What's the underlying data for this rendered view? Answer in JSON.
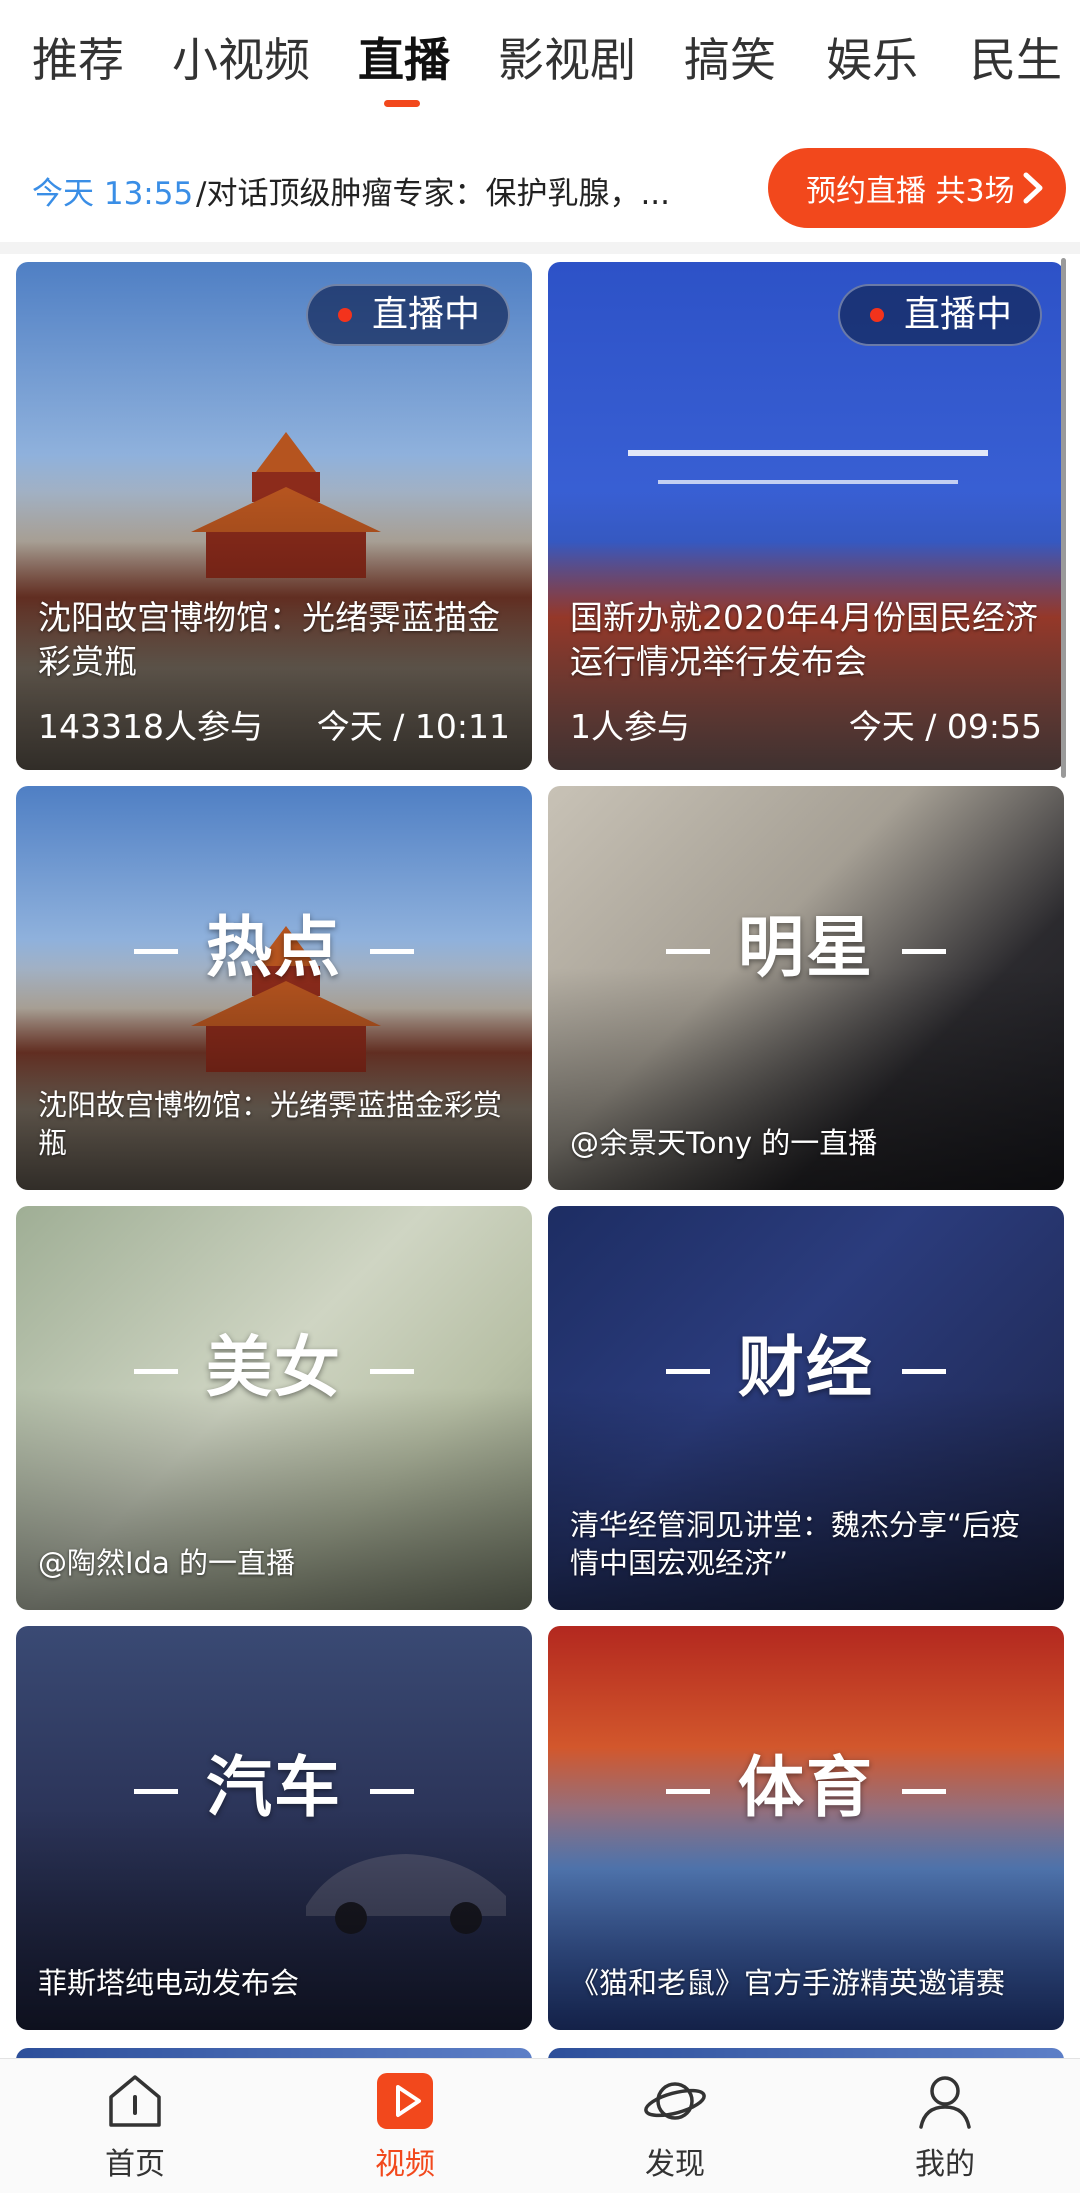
{
  "tabs": [
    "推荐",
    "小视频",
    "直播",
    "影视剧",
    "搞笑",
    "娱乐",
    "民生"
  ],
  "active_tab": "直播",
  "schedule": {
    "time": "今天 13:55",
    "title": "/对话顶级肿瘤专家：保护乳腺，...",
    "reserve_label": "预约直播 共3场"
  },
  "live_cards": [
    {
      "badge": "直播中",
      "title": "沈阳故宫博物馆：光绪霁蓝描金彩赏瓶",
      "participants": "143318人参与",
      "time": "今天 / 10:11"
    },
    {
      "badge": "直播中",
      "title": "国新办就2020年4月份国民经济运行情况举行发布会",
      "participants": "1人参与",
      "time": "今天 / 09:55"
    }
  ],
  "category_cards": [
    {
      "category": "热点",
      "caption": "沈阳故宫博物馆：光绪霁蓝描金彩赏瓶"
    },
    {
      "category": "明星",
      "caption": "@余景天Tony 的一直播"
    },
    {
      "category": "美女",
      "caption": "@陶然Ida 的一直播"
    },
    {
      "category": "财经",
      "caption": "清华经管洞见讲堂：魏杰分享“后疫情中国宏观经济”"
    },
    {
      "category": "汽车",
      "caption": "菲斯塔纯电动发布会"
    },
    {
      "category": "体育",
      "caption": "《猫和老鼠》官方手游精英邀请赛"
    }
  ],
  "bottom_nav": [
    {
      "label": "首页",
      "icon": "home-icon"
    },
    {
      "label": "视频",
      "icon": "video-play-icon"
    },
    {
      "label": "发现",
      "icon": "planet-icon"
    },
    {
      "label": "我的",
      "icon": "person-icon"
    }
  ],
  "colors": {
    "accent": "#f2481c",
    "time_blue": "#3a8ee6",
    "live_dot": "#f3331c"
  }
}
